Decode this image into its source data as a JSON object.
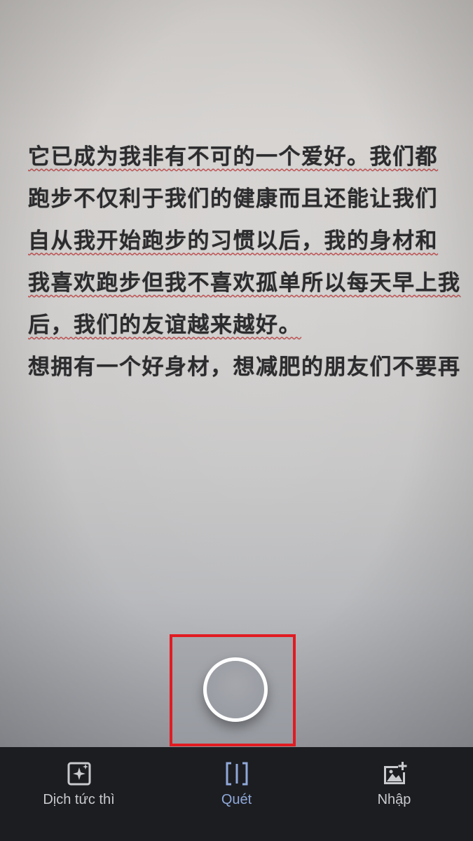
{
  "document": {
    "lines": [
      "它已成为我非有不可的一个爱好。我们都",
      "跑步不仅利于我们的健康而且还能让我们",
      "自从我开始跑步的习惯以后，我的身材和",
      "我喜欢跑步但我不喜欢孤单所以每天早上我",
      "后，我们的友谊越来越好。",
      "想拥有一个好身材，想减肥的朋友们不要再"
    ]
  },
  "shutter": {
    "icon": "camera-shutter-icon"
  },
  "bottom_nav": {
    "items": [
      {
        "label": "Dịch tức thì",
        "icon": "instant-translate-icon",
        "active": false
      },
      {
        "label": "Quét",
        "icon": "scan-icon",
        "active": true
      },
      {
        "label": "Nhập",
        "icon": "import-image-icon",
        "active": false
      }
    ]
  },
  "colors": {
    "highlight_box": "#e11b22",
    "active_tab": "#8fa8d8",
    "nav_background": "#1c1d21"
  }
}
